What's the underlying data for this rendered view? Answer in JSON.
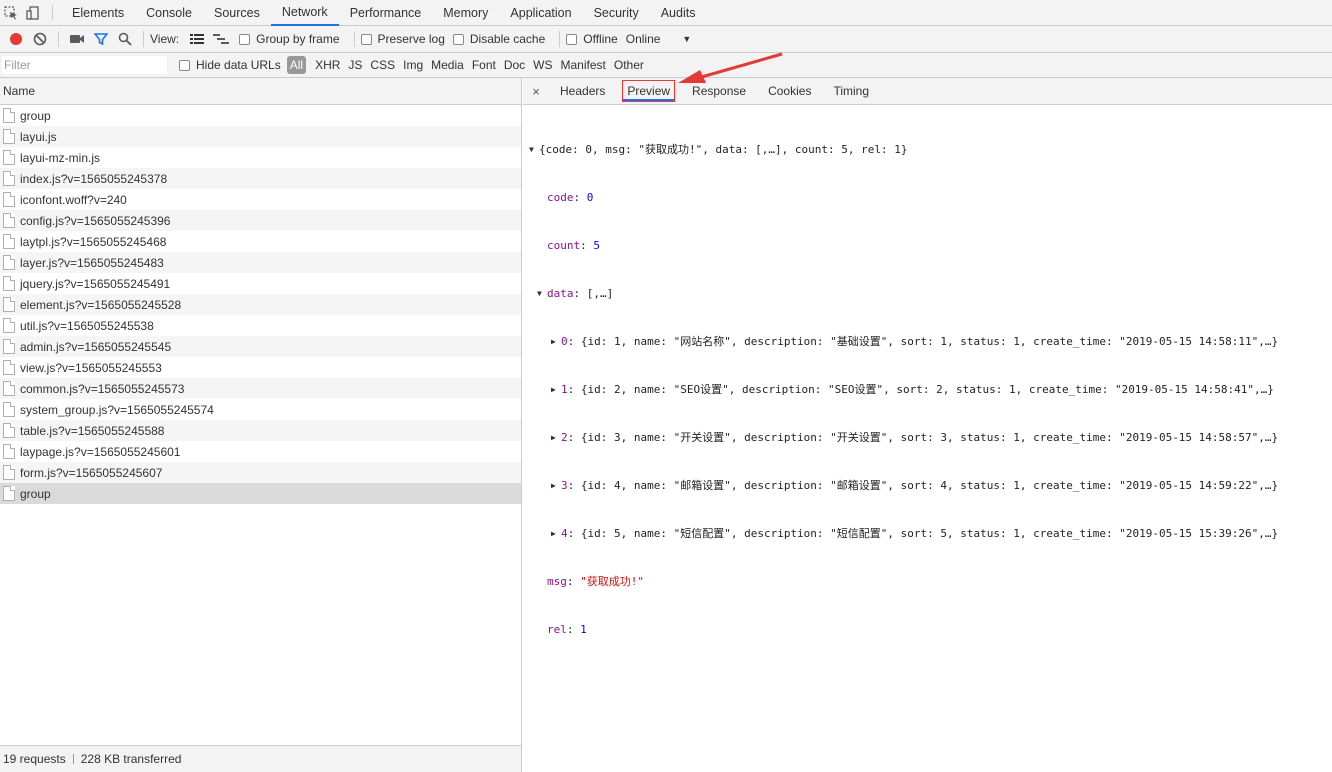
{
  "topbar": {
    "tabs": [
      "Elements",
      "Console",
      "Sources",
      "Network",
      "Performance",
      "Memory",
      "Application",
      "Security",
      "Audits"
    ],
    "active": "Network"
  },
  "toolbar": {
    "view_label": "View:",
    "group_by_frame": "Group by frame",
    "preserve_log": "Preserve log",
    "disable_cache": "Disable cache",
    "offline": "Offline",
    "throttle": "Online"
  },
  "filterbar": {
    "placeholder": "Filter",
    "hide_data_urls": "Hide data URLs",
    "types": [
      "All",
      "XHR",
      "JS",
      "CSS",
      "Img",
      "Media",
      "Font",
      "Doc",
      "WS",
      "Manifest",
      "Other"
    ]
  },
  "requests": {
    "header": "Name",
    "items": [
      "group",
      "layui.js",
      "layui-mz-min.js",
      "index.js?v=1565055245378",
      "iconfont.woff?v=240",
      "config.js?v=1565055245396",
      "laytpl.js?v=1565055245468",
      "layer.js?v=1565055245483",
      "jquery.js?v=1565055245491",
      "element.js?v=1565055245528",
      "util.js?v=1565055245538",
      "admin.js?v=1565055245545",
      "view.js?v=1565055245553",
      "common.js?v=1565055245573",
      "system_group.js?v=1565055245574",
      "table.js?v=1565055245588",
      "laypage.js?v=1565055245601",
      "form.js?v=1565055245607",
      "group"
    ],
    "summary_requests": "19 requests",
    "summary_transferred": "228 KB transferred"
  },
  "detail": {
    "close": "×",
    "tabs": [
      "Headers",
      "Preview",
      "Response",
      "Cookies",
      "Timing"
    ],
    "active": "Preview"
  },
  "preview": {
    "root": "{code: 0, msg: \"获取成功!\", data: [,…], count: 5, rel: 1}",
    "code_key": "code",
    "code_val": "0",
    "count_key": "count",
    "count_val": "5",
    "data_key": "data",
    "data_summary": "[,…]",
    "data_items": [
      {
        "idx": "0",
        "text": "{id: 1, name: \"网站名称\", description: \"基础设置\", sort: 1, status: 1, create_time: \"2019-05-15 14:58:11\",…}"
      },
      {
        "idx": "1",
        "text": "{id: 2, name: \"SEO设置\", description: \"SEO设置\", sort: 2, status: 1, create_time: \"2019-05-15 14:58:41\",…}"
      },
      {
        "idx": "2",
        "text": "{id: 3, name: \"开关设置\", description: \"开关设置\", sort: 3, status: 1, create_time: \"2019-05-15 14:58:57\",…}"
      },
      {
        "idx": "3",
        "text": "{id: 4, name: \"邮箱设置\", description: \"邮箱设置\", sort: 4, status: 1, create_time: \"2019-05-15 14:59:22\",…}"
      },
      {
        "idx": "4",
        "text": "{id: 5, name: \"短信配置\", description: \"短信配置\", sort: 5, status: 1, create_time: \"2019-05-15 15:39:26\",…}"
      }
    ],
    "msg_key": "msg",
    "msg_val": "\"获取成功!\"",
    "rel_key": "rel",
    "rel_val": "1"
  },
  "colors": {
    "accent": "#1a73e8",
    "record": "#e53935",
    "annotation": "#e53935"
  }
}
